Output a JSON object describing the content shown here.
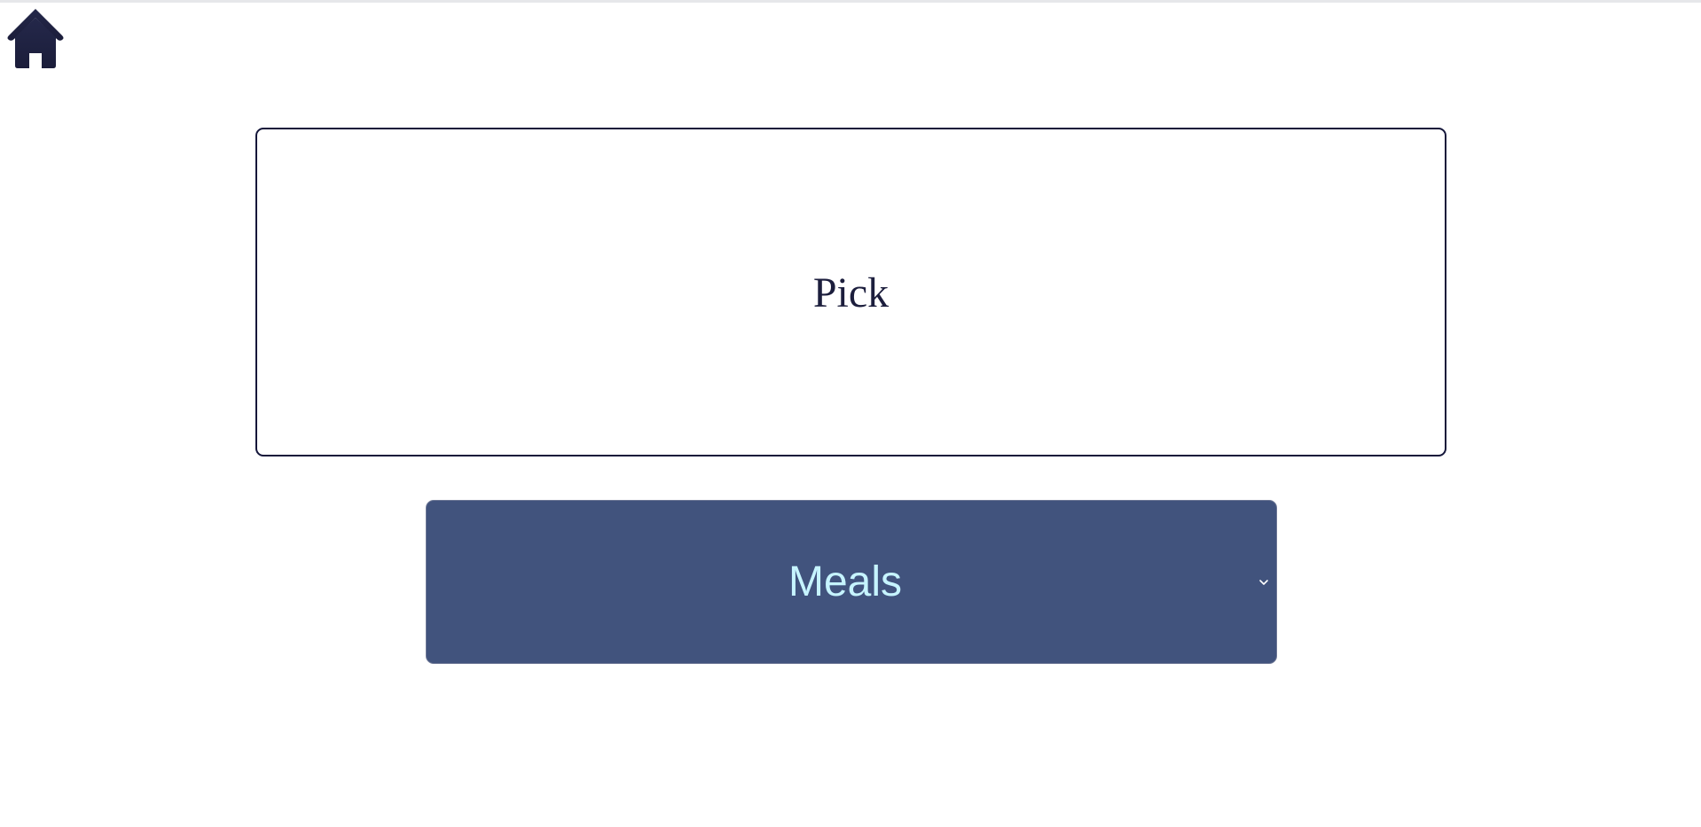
{
  "home": {
    "icon": "home-icon",
    "color": "#1c1e3d"
  },
  "pick_card": {
    "text": "Pick",
    "border_color": "#14163a"
  },
  "meals_select": {
    "selected": "Meals",
    "background": "#41537d",
    "text_color": "#c6f4ff",
    "icon": "chevron-down-icon"
  }
}
